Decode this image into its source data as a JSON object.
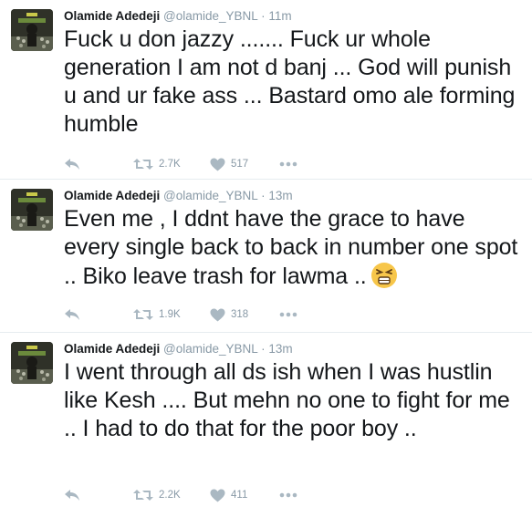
{
  "colors": {
    "name": "#14171a",
    "meta": "#8899a6",
    "icon": "#aab8c2",
    "border": "#e6ecf0"
  },
  "icons": {
    "reply": "reply-arrow-icon",
    "retweet": "retweet-icon",
    "like": "heart-icon",
    "more": "more-dots-icon",
    "emoji": "persevering-face-emoji"
  },
  "tweets": [
    {
      "name": "Olamide Adedeji",
      "handle": "@olamide_YBNL",
      "sep": "·",
      "time": "11m",
      "text": "Fuck u don jazzy ....... Fuck ur whole generation I am not d banj ... God will punish u and ur fake ass ... Bastard omo ale forming humble",
      "retweets": "2.7K",
      "likes": "517"
    },
    {
      "name": "Olamide Adedeji",
      "handle": "@olamide_YBNL",
      "sep": "·",
      "time": "13m",
      "text": "Even me , I ddnt have the grace to have every single back to back in number one spot .. Biko leave trash for lawma ..",
      "emoji": "😣",
      "retweets": "1.9K",
      "likes": "318"
    },
    {
      "name": "Olamide Adedeji",
      "handle": "@olamide_YBNL",
      "sep": "·",
      "time": "13m",
      "text": "I went through all ds ish when I was hustlin like Kesh .... But mehn no one to fight for me .. I had to do that for the poor boy ..",
      "retweets": "2.2K",
      "likes": "411"
    }
  ]
}
